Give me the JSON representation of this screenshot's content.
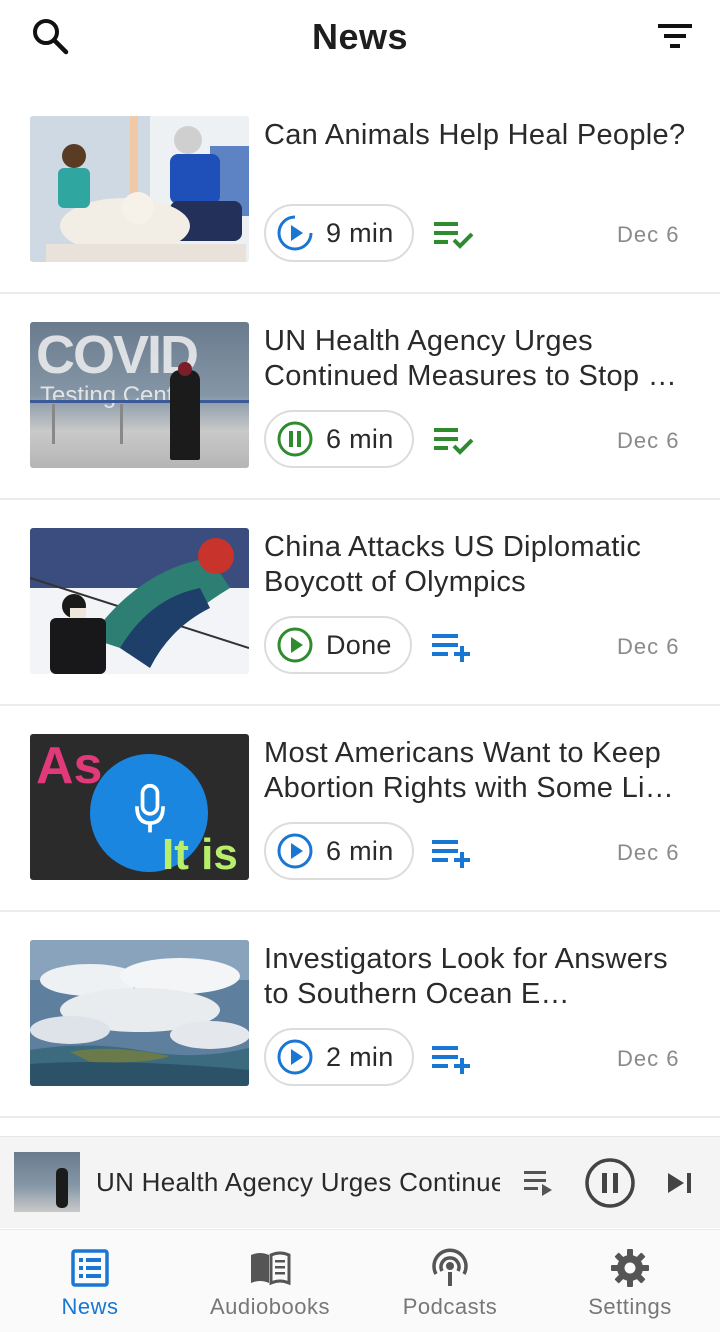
{
  "header": {
    "title": "News"
  },
  "colors": {
    "accent": "#1976d2",
    "green": "#2e8b2e",
    "muted": "#8a8a8a"
  },
  "articles": [
    {
      "title": "Can Animals Help Heal People?",
      "duration": "9 min",
      "state": "play",
      "queued": true,
      "date": "Dec 6"
    },
    {
      "title": "UN Health Agency Urges Continued Measures to Stop …",
      "duration": "6 min",
      "state": "pause",
      "queued": true,
      "date": "Dec 6"
    },
    {
      "title": "China Attacks US Diplomatic Boycott of Olympics",
      "duration": "Done",
      "state": "done",
      "queued": false,
      "date": "Dec 6"
    },
    {
      "title": "Most Americans Want to Keep Abortion Rights with Some Li…",
      "duration": "6 min",
      "state": "play",
      "queued": false,
      "date": "Dec 6"
    },
    {
      "title": "Investigators Look for Answers to Southern Ocean E…",
      "duration": "2 min",
      "state": "play",
      "queued": false,
      "date": "Dec 6"
    }
  ],
  "thumbnails": {
    "covid_text": "COVID",
    "covid_sub": "Testing Center",
    "asitis_top": "As",
    "asitis_bottom": "It is"
  },
  "mini_player": {
    "title": "UN Health Agency Urges Continued Measures to Stop",
    "state": "playing"
  },
  "nav": [
    {
      "label": "News",
      "icon": "newspaper-icon",
      "active": true
    },
    {
      "label": "Audiobooks",
      "icon": "book-icon",
      "active": false
    },
    {
      "label": "Podcasts",
      "icon": "podcast-icon",
      "active": false
    },
    {
      "label": "Settings",
      "icon": "gear-icon",
      "active": false
    }
  ]
}
